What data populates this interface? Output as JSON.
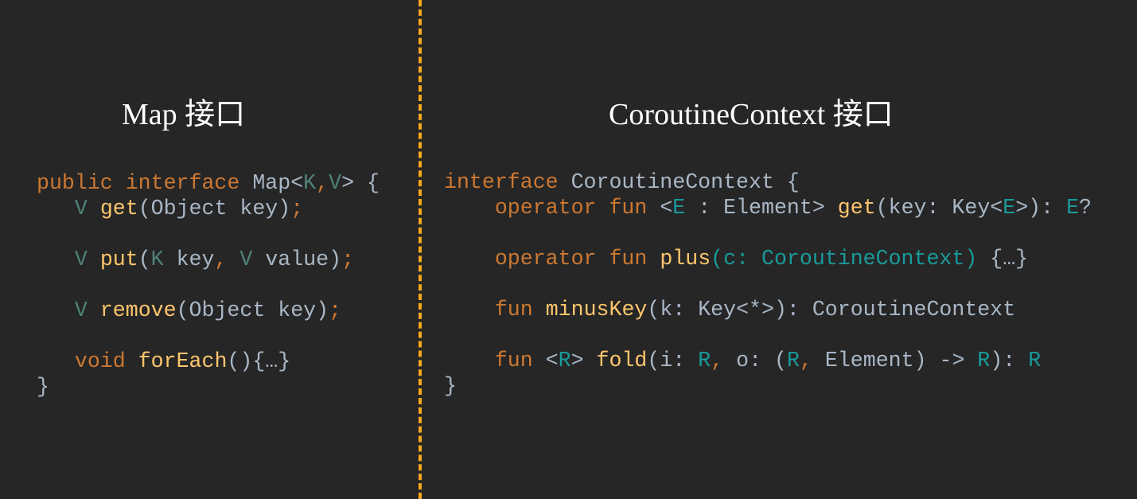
{
  "left_title": "Map 接口",
  "right_title": "CoroutineContext 接口",
  "colors": {
    "background": "#262626",
    "divider": "#f7a81b",
    "keyword": "#cc7832",
    "function": "#ffc66d",
    "text": "#a9b7c6"
  },
  "left_code": [
    [
      [
        "public interface ",
        "kw"
      ],
      [
        "Map<",
        "tx"
      ],
      [
        "K",
        "tp"
      ],
      [
        ",",
        "kw"
      ],
      [
        "V",
        "tp"
      ],
      [
        "> {",
        "tx"
      ]
    ],
    [
      [
        "   ",
        ""
      ],
      [
        "V ",
        "tp"
      ],
      [
        "get",
        "fn"
      ],
      [
        "(Object key)",
        "tx"
      ],
      [
        ";",
        "kw"
      ]
    ],
    [],
    [
      [
        "   ",
        ""
      ],
      [
        "V ",
        "tp"
      ],
      [
        "put",
        "fn"
      ],
      [
        "(",
        "tx"
      ],
      [
        "K ",
        "tp"
      ],
      [
        "key",
        "tx"
      ],
      [
        ", ",
        "kw"
      ],
      [
        "V ",
        "tp"
      ],
      [
        "value)",
        "tx"
      ],
      [
        ";",
        "kw"
      ]
    ],
    [],
    [
      [
        "   ",
        ""
      ],
      [
        "V ",
        "tp"
      ],
      [
        "remove",
        "fn"
      ],
      [
        "(Object key)",
        "tx"
      ],
      [
        ";",
        "kw"
      ]
    ],
    [],
    [
      [
        "   ",
        ""
      ],
      [
        "void ",
        "kw"
      ],
      [
        "forEach",
        "fn"
      ],
      [
        "(){…}",
        "tx"
      ]
    ],
    [
      [
        "}",
        "tx"
      ]
    ]
  ],
  "right_code": [
    [
      [
        "interface ",
        "kw"
      ],
      [
        "CoroutineContext {",
        "tx"
      ]
    ],
    [
      [
        "    ",
        ""
      ],
      [
        "operator fun ",
        "kw"
      ],
      [
        "<",
        "tx"
      ],
      [
        "E",
        "tc"
      ],
      [
        " : Element> ",
        "tx"
      ],
      [
        "get",
        "fn"
      ],
      [
        "(key: Key<",
        "tx"
      ],
      [
        "E",
        "tc"
      ],
      [
        ">): ",
        "tx"
      ],
      [
        "E",
        "tc"
      ],
      [
        "?",
        "tx"
      ]
    ],
    [],
    [
      [
        "    ",
        ""
      ],
      [
        "operator fun ",
        "kw"
      ],
      [
        "plus",
        "fn"
      ],
      [
        "(c: CoroutineContext)",
        "tc"
      ],
      [
        " {…}",
        "tx"
      ]
    ],
    [],
    [
      [
        "    ",
        ""
      ],
      [
        "fun ",
        "kw"
      ],
      [
        "minusKey",
        "fn"
      ],
      [
        "(k: Key<*>): CoroutineContext",
        "tx"
      ]
    ],
    [],
    [
      [
        "    ",
        ""
      ],
      [
        "fun ",
        "kw"
      ],
      [
        "<",
        "tx"
      ],
      [
        "R",
        "tc"
      ],
      [
        "> ",
        "tx"
      ],
      [
        "fold",
        "fn"
      ],
      [
        "(i: ",
        "tx"
      ],
      [
        "R",
        "tc"
      ],
      [
        ", ",
        "kw"
      ],
      [
        "o: (",
        "tx"
      ],
      [
        "R",
        "tc"
      ],
      [
        ", ",
        "kw"
      ],
      [
        "Element) -> ",
        "tx"
      ],
      [
        "R",
        "tc"
      ],
      [
        "): ",
        "tx"
      ],
      [
        "R",
        "tc"
      ]
    ],
    [
      [
        "}",
        "tx"
      ]
    ]
  ]
}
